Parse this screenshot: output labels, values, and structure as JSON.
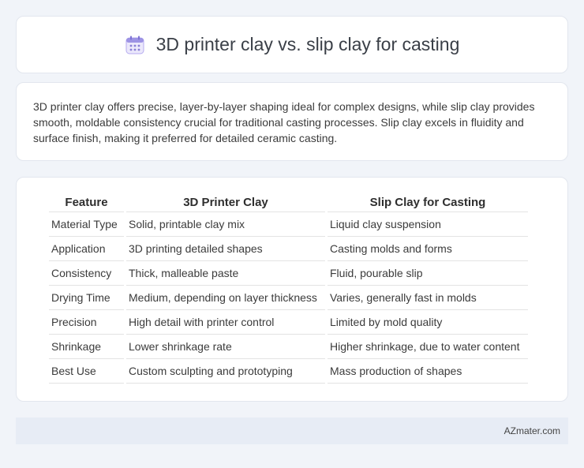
{
  "header": {
    "icon": "calendar-icon",
    "title": "3D printer clay vs. slip clay for casting"
  },
  "description": "3D printer clay offers precise, layer-by-layer shaping ideal for complex designs, while slip clay provides smooth, moldable consistency crucial for traditional casting processes. Slip clay excels in fluidity and surface finish, making it preferred for detailed ceramic casting.",
  "table": {
    "headers": [
      "Feature",
      "3D Printer Clay",
      "Slip Clay for Casting"
    ],
    "rows": [
      [
        "Material Type",
        "Solid, printable clay mix",
        "Liquid clay suspension"
      ],
      [
        "Application",
        "3D printing detailed shapes",
        "Casting molds and forms"
      ],
      [
        "Consistency",
        "Thick, malleable paste",
        "Fluid, pourable slip"
      ],
      [
        "Drying Time",
        "Medium, depending on layer thickness",
        "Varies, generally fast in molds"
      ],
      [
        "Precision",
        "High detail with printer control",
        "Limited by mold quality"
      ],
      [
        "Shrinkage",
        "Lower shrinkage rate",
        "Higher shrinkage, due to water content"
      ],
      [
        "Best Use",
        "Custom sculpting and prototyping",
        "Mass production of shapes"
      ]
    ]
  },
  "footer": {
    "source": "AZmater.com"
  },
  "colors": {
    "background": "#f1f4f9",
    "card": "#ffffff",
    "footer_bg": "#e7ecf5",
    "icon_accent": "#8a7fd6"
  }
}
